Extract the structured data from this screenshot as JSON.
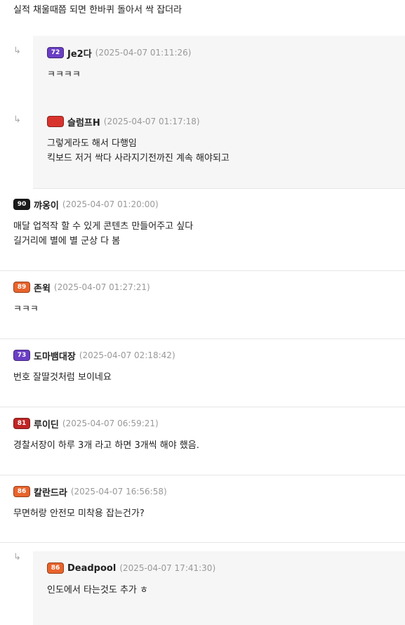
{
  "top_text": "실적 채울때쯤 되면 한바퀴 돌아서 싹 잡더라",
  "reply_arrow": "↳",
  "comments": [
    {
      "nick": "Je2다",
      "level": "72",
      "badge_color": "#6a3fc4",
      "date": "(2025-04-07 01:11:26)",
      "lines": [
        "ㅋㅋㅋㅋ"
      ]
    },
    {
      "nick": "슬럼프H",
      "level": "",
      "badge_color": "#d8342d",
      "date": "(2025-04-07 01:17:18)",
      "lines": [
        "그렇게라도 해서 다행임",
        "킥보드 저거 싹다 사라지기전까진 계속 해야되고"
      ]
    },
    {
      "nick": "꺄옹이",
      "level": "90",
      "badge_color": "#1a1a1a",
      "date": "(2025-04-07 01:20:00)",
      "lines": [
        "매달 업적작 할 수 있게 콘텐츠 만들어주고 싶다",
        "길거리에 별에 별 군상 다 봄"
      ]
    },
    {
      "nick": "존윅",
      "level": "89",
      "badge_color": "#e8642c",
      "date": "(2025-04-07 01:27:21)",
      "lines": [
        "ㅋㅋㅋ"
      ]
    },
    {
      "nick": "도마뱀대장",
      "level": "73",
      "badge_color": "#6a3fc4",
      "date": "(2025-04-07 02:18:42)",
      "lines": [
        "번호 잘딸것처럼 보이네요"
      ]
    },
    {
      "nick": "루이딘",
      "level": "81",
      "badge_color": "#c02525",
      "date": "(2025-04-07 06:59:21)",
      "lines": [
        "경찰서장이 하루 3개 라고 하면 3개씩 해야 했음."
      ]
    },
    {
      "nick": "칼란드라",
      "level": "86",
      "badge_color": "#e8642c",
      "date": "(2025-04-07 16:56:58)",
      "lines": [
        "무면허랑 안전모 미착용 잡는건가?"
      ]
    },
    {
      "nick": "Deadpool",
      "level": "86",
      "badge_color": "#e8642c",
      "date": "(2025-04-07 17:41:30)",
      "lines": [
        "인도에서 타는것도 추가 ㅎ"
      ]
    }
  ]
}
